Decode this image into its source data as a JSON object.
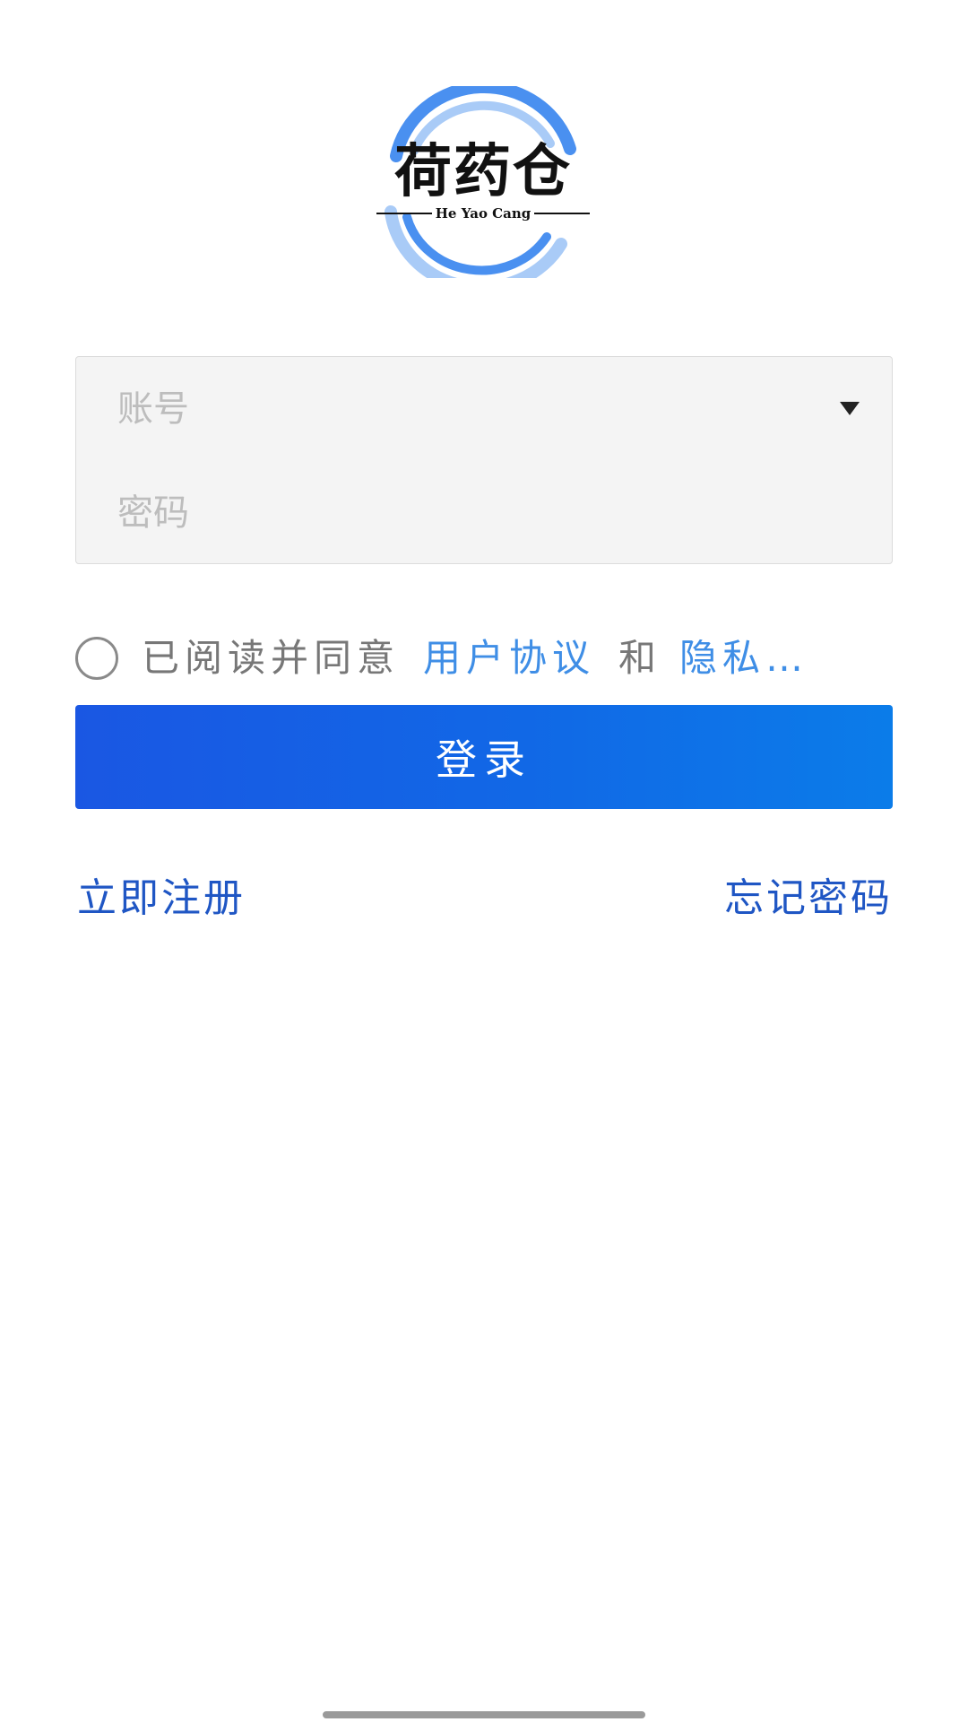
{
  "logo": {
    "title": "荷药仓",
    "subtitle": "He Yao Cang",
    "ring_color": "#4a90f0",
    "ring_light_color": "#a9cbf7"
  },
  "form": {
    "account_placeholder": "账号",
    "password_placeholder": "密码",
    "account_icon": "chevron-down-icon"
  },
  "agreement": {
    "prefix": "已阅读并同意",
    "user_agreement": "用户协议",
    "and": "和",
    "privacy_policy": "隐私…",
    "link_color": "#3f8ee6"
  },
  "login_button": {
    "label": "登录",
    "color_start": "#1a57e3",
    "color_end": "#0b7ce9"
  },
  "links": {
    "register": "立即注册",
    "forgot_password": "忘记密码",
    "color": "#1f56c4"
  }
}
